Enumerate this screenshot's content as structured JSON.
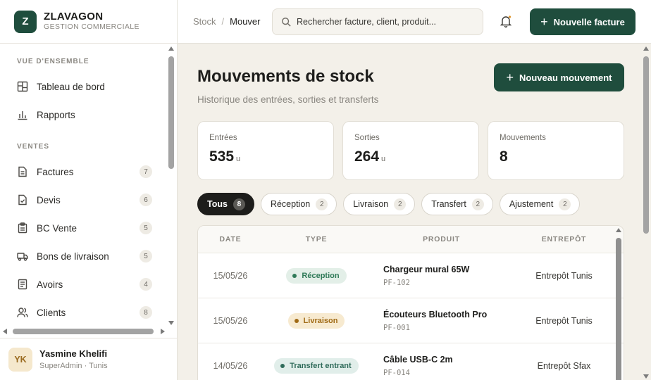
{
  "brand": {
    "logo_letter": "Z",
    "name": "ZLAVAGON",
    "subtitle": "GESTION COMMERCIALE"
  },
  "sidebar": {
    "sections": [
      {
        "title": "VUE D'ENSEMBLE",
        "items": [
          {
            "label": "Tableau de bord",
            "icon": "dashboard-icon"
          },
          {
            "label": "Rapports",
            "icon": "bar-chart-icon"
          }
        ]
      },
      {
        "title": "VENTES",
        "items": [
          {
            "label": "Factures",
            "icon": "document-icon",
            "count": "7"
          },
          {
            "label": "Devis",
            "icon": "document-check-icon",
            "count": "6"
          },
          {
            "label": "BC Vente",
            "icon": "clipboard-icon",
            "count": "5"
          },
          {
            "label": "Bons de livraison",
            "icon": "truck-icon",
            "count": "5"
          },
          {
            "label": "Avoirs",
            "icon": "receipt-icon",
            "count": "4"
          },
          {
            "label": "Clients",
            "icon": "users-icon",
            "count": "8"
          }
        ]
      }
    ]
  },
  "user": {
    "initials": "YK",
    "name": "Yasmine Khelifi",
    "role": "SuperAdmin · Tunis"
  },
  "topbar": {
    "breadcrumb": [
      "Stock",
      "Mouver"
    ],
    "search_placeholder": "Rechercher facture, client, produit...",
    "new_invoice_label": "Nouvelle facture"
  },
  "page": {
    "title": "Mouvements de stock",
    "subtitle": "Historique des entrées, sorties et transferts",
    "new_movement_label": "Nouveau mouvement"
  },
  "stats": [
    {
      "label": "Entrées",
      "value": "535",
      "unit": "u"
    },
    {
      "label": "Sorties",
      "value": "264",
      "unit": "u"
    },
    {
      "label": "Mouvements",
      "value": "8",
      "unit": ""
    }
  ],
  "filters": [
    {
      "label": "Tous",
      "count": "8",
      "active": true
    },
    {
      "label": "Réception",
      "count": "2"
    },
    {
      "label": "Livraison",
      "count": "2"
    },
    {
      "label": "Transfert",
      "count": "2"
    },
    {
      "label": "Ajustement",
      "count": "2"
    }
  ],
  "table": {
    "columns": [
      "DATE",
      "TYPE",
      "PRODUIT",
      "ENTREPÔT"
    ],
    "rows": [
      {
        "date": "15/05/26",
        "type": "Réception",
        "type_color": "#2f7a58",
        "type_bg": "#e3efe8",
        "product": "Chargeur mural 65W",
        "sku": "PF-102",
        "warehouse": "Entrepôt Tunis"
      },
      {
        "date": "15/05/26",
        "type": "Livraison",
        "type_color": "#a06a15",
        "type_bg": "#f7ead0",
        "product": "Écouteurs Bluetooth Pro",
        "sku": "PF-001",
        "warehouse": "Entrepôt Tunis"
      },
      {
        "date": "14/05/26",
        "type": "Transfert entrant",
        "type_color": "#2f6b5a",
        "type_bg": "#e1eeea",
        "product": "Câble USB-C 2m",
        "sku": "PF-014",
        "warehouse": "Entrepôt Sfax"
      }
    ]
  }
}
